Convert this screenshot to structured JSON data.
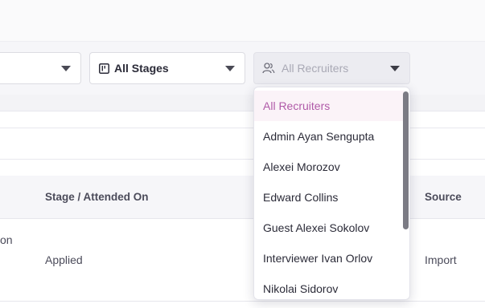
{
  "filters": {
    "stages_label": "All Stages",
    "recruiters_placeholder": "All Recruiters"
  },
  "table": {
    "headers": {
      "stage": "Stage / Attended On",
      "source": "Source"
    },
    "rows": [
      {
        "name_fragment": "on",
        "stage": "Applied",
        "source": "Import"
      }
    ]
  },
  "recruiter_dropdown": {
    "selected": "All Recruiters",
    "options": [
      "All Recruiters",
      "Admin Ayan Sengupta",
      "Alexei Morozov",
      "Edward Collins",
      "Guest Alexei Sokolov",
      "Interviewer Ivan Orlov",
      "Nikolai Sidorov"
    ]
  },
  "colors": {
    "accent": "#b05aa8",
    "selected_bg": "#fbf3f8",
    "header_bg": "#f6f6f9"
  }
}
